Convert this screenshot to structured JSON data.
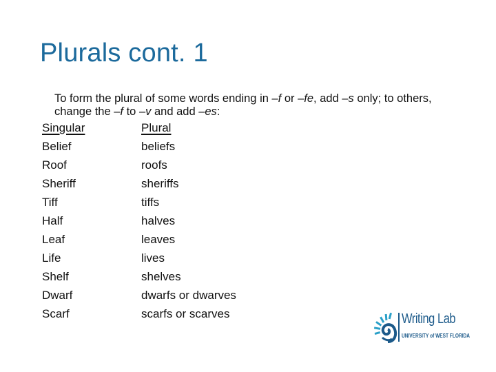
{
  "slide": {
    "title": "Plurals cont. 1",
    "intro": {
      "p1": "To form the plural of some words ending in ",
      "f1": "–f",
      "p2": " or ",
      "fe": "–fe",
      "p3": ", add ",
      "s": "–s",
      "p4": " only; to others, change the ",
      "f2": "–f",
      "p5": " to ",
      "v": "–v",
      "p6": " and add ",
      "es": "–es",
      "p7": ":"
    },
    "table": {
      "headers": {
        "singular": "Singular",
        "plural": "Plural"
      },
      "rows": [
        {
          "singular": "Belief",
          "plural": "beliefs"
        },
        {
          "singular": "Roof",
          "plural": "roofs"
        },
        {
          "singular": "Sheriff",
          "plural": "sheriffs"
        },
        {
          "singular": "Tiff",
          "plural": "tiffs"
        },
        {
          "singular": "Half",
          "plural": "halves"
        },
        {
          "singular": "Leaf",
          "plural": "leaves"
        },
        {
          "singular": "Life",
          "plural": "lives"
        },
        {
          "singular": "Shelf",
          "plural": "shelves"
        },
        {
          "singular": "Dwarf",
          "plural": "dwarfs or dwarves"
        },
        {
          "singular": "Scarf",
          "plural": "scarfs or scarves"
        }
      ]
    },
    "logo": {
      "name": "Writing Lab",
      "subtitle": "UNIVERSITY of WEST FLORIDA",
      "icon": "nautilus-shell-icon"
    },
    "colors": {
      "title": "#1c6a9c",
      "logo": "#1c5a8a",
      "logo_accent": "#2aa0c8"
    }
  }
}
